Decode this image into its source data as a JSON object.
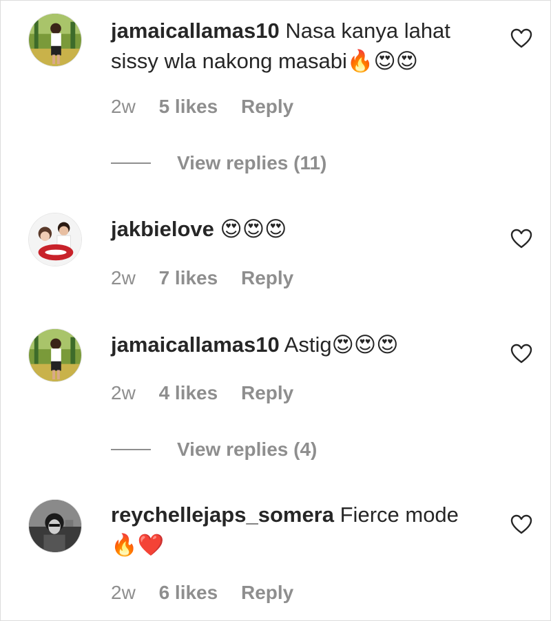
{
  "comments": [
    {
      "username": "jamaicallamas10",
      "text": "Nasa kanya lahat sissy wla nakong masabi🔥😍😍",
      "time": "2w",
      "likes": "5 likes",
      "reply_label": "Reply",
      "view_replies": "View replies (11)",
      "avatar_icon": "profile-photo-girl-outdoors"
    },
    {
      "username": "jakbielove",
      "text": "😍😍😍",
      "time": "2w",
      "likes": "7 likes",
      "reply_label": "Reply",
      "avatar_icon": "profile-photo-couple"
    },
    {
      "username": "jamaicallamas10",
      "text": "Astig😍😍😍",
      "time": "2w",
      "likes": "4 likes",
      "reply_label": "Reply",
      "view_replies": "View replies (4)",
      "avatar_icon": "profile-photo-girl-outdoors"
    },
    {
      "username": "reychellejaps_somera",
      "text": "Fierce mode🔥❤️",
      "time": "2w",
      "likes": "6 likes",
      "reply_label": "Reply",
      "avatar_icon": "profile-photo-woman-bw"
    }
  ],
  "colors": {
    "text": "#262626",
    "secondary": "#8e8e8e",
    "background": "#ffffff"
  }
}
